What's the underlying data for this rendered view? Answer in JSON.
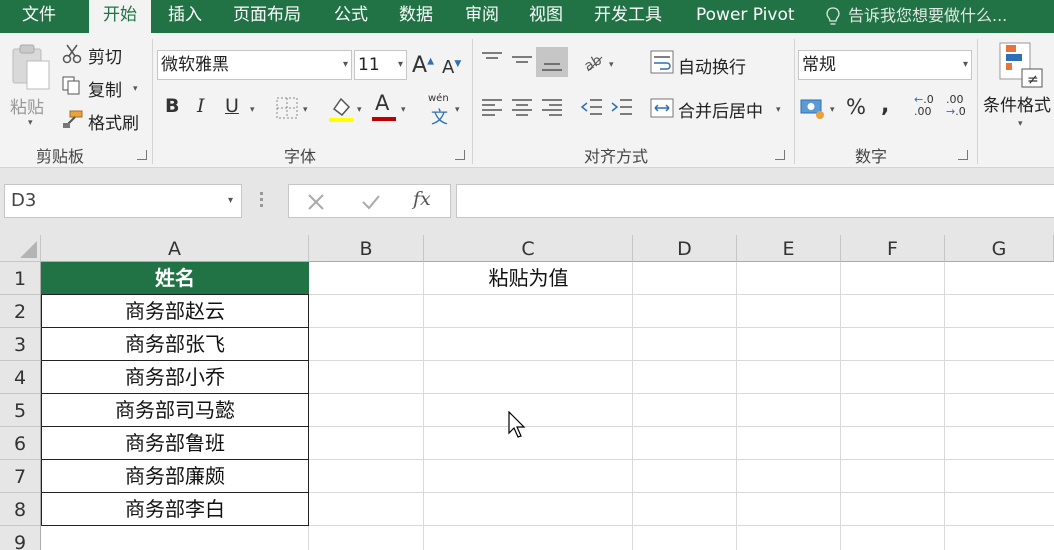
{
  "tabs": [
    {
      "label": "文件"
    },
    {
      "label": "开始"
    },
    {
      "label": "插入"
    },
    {
      "label": "页面布局"
    },
    {
      "label": "公式"
    },
    {
      "label": "数据"
    },
    {
      "label": "审阅"
    },
    {
      "label": "视图"
    },
    {
      "label": "开发工具"
    },
    {
      "label": "Power Pivot"
    }
  ],
  "tell_me": "告诉我您想要做什么...",
  "clipboard": {
    "paste": "粘贴",
    "cut": "剪切",
    "copy": "复制",
    "format_painter": "格式刷",
    "group": "剪贴板"
  },
  "font": {
    "name": "微软雅黑",
    "size": "11",
    "bold": "B",
    "italic": "I",
    "underline": "U",
    "phonetic_top": "wén",
    "phonetic_bottom": "文",
    "group": "字体"
  },
  "alignment": {
    "wrap": "自动换行",
    "merge": "合并后居中",
    "group": "对齐方式"
  },
  "number": {
    "format": "常规",
    "percent": "%",
    "comma": ",",
    "inc_decimal": "←.0\n.00",
    "group": "数字"
  },
  "styles": {
    "conditional": "条件格式"
  },
  "formula_bar": {
    "name_box": "D3",
    "fx": "fx",
    "content": ""
  },
  "columns": [
    "A",
    "B",
    "C",
    "D",
    "E",
    "F",
    "G"
  ],
  "rows": [
    "1",
    "2",
    "3",
    "4",
    "5",
    "6",
    "7",
    "8",
    "9"
  ],
  "cells": {
    "A1": "姓名",
    "C1": "粘贴为值",
    "A2": "商务部赵云",
    "A3": "商务部张飞",
    "A4": "商务部小乔",
    "A5": "商务部司马懿",
    "A6": "商务部鲁班",
    "A7": "商务部廉颇",
    "A8": "商务部李白"
  },
  "colors": {
    "excel_green": "#217346",
    "font_color_red": "#c00000",
    "highlight_yellow": "#ffff00"
  }
}
